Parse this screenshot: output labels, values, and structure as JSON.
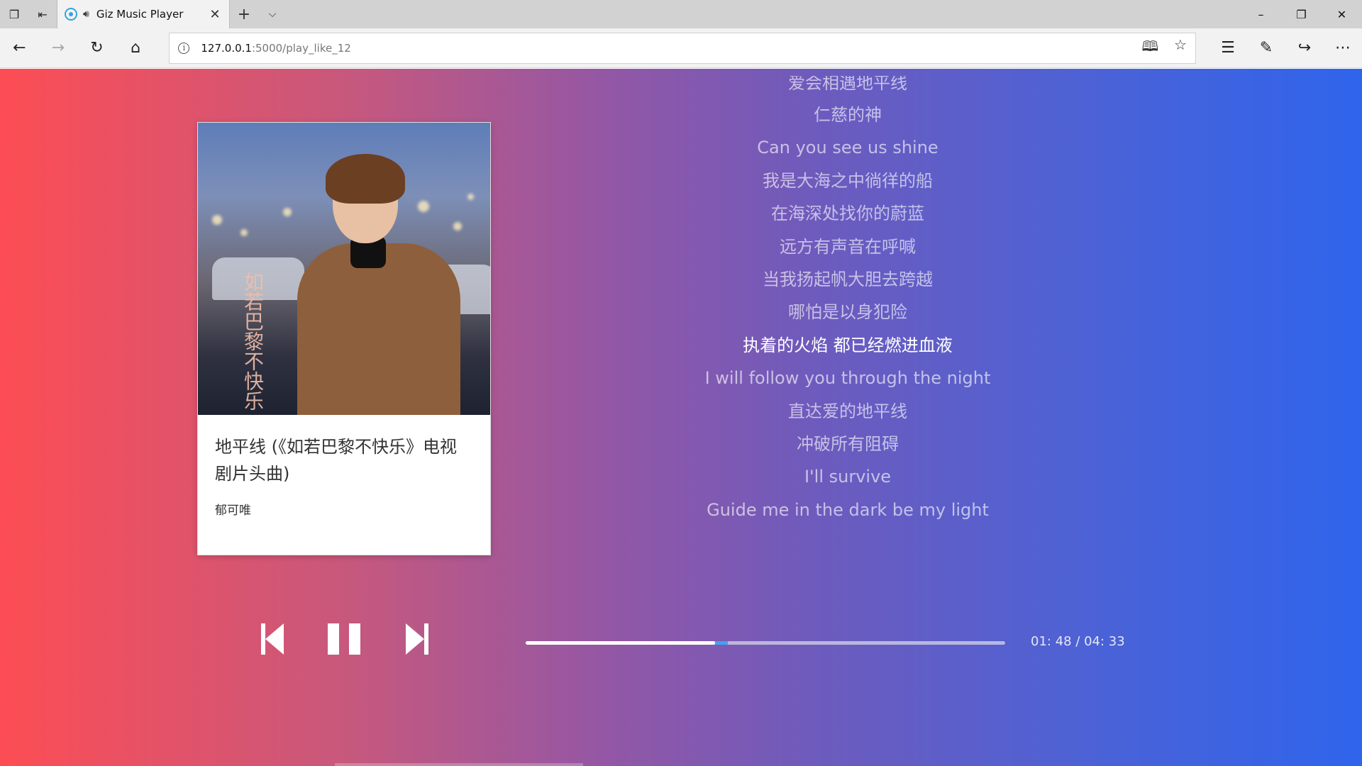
{
  "browser": {
    "tab": {
      "title": "Giz Music Player"
    },
    "address": {
      "host": "127.0.0.1",
      "path": ":5000/play_like_12"
    }
  },
  "song": {
    "title": "地平线 (《如若巴黎不快乐》电视剧片头曲)",
    "artist": "郁可唯",
    "cover_text": "如若巴黎不快乐"
  },
  "lyrics": {
    "lines": [
      "爱会相遇地平线",
      "仁慈的神",
      "Can you see us shine",
      "我是大海之中徜徉的船",
      "在海深处找你的蔚蓝",
      "远方有声音在呼喊",
      "当我扬起帆大胆去跨越",
      "哪怕是以身犯险",
      "执着的火焰 都已经燃进血液",
      "I will follow you through the night",
      "直达爱的地平线",
      "冲破所有阻碍",
      "I'll survive",
      "Guide me in the dark be my light"
    ],
    "active_index": 8
  },
  "player": {
    "current_time": "01: 48",
    "total_time": "04: 33",
    "time_display": "01: 48 / 04: 33",
    "progress": 0.395,
    "state": "playing"
  },
  "colors": {
    "gradient_start": "#fd4d54",
    "gradient_end": "#2f64ec",
    "progress_buffer": "#41a3ee"
  }
}
